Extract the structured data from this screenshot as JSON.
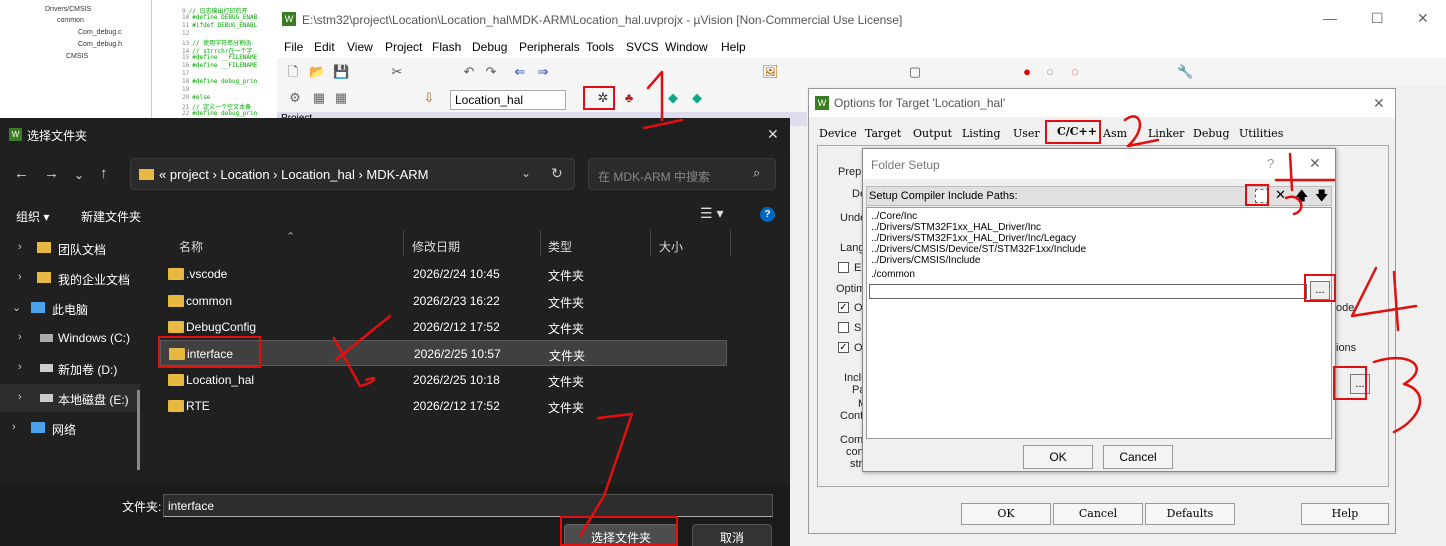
{
  "background_tree": {
    "items": [
      "Drivers/CMSIS",
      "common",
      "Com_debug.c",
      "Com_debug.h",
      "CMSIS"
    ]
  },
  "background_code": {
    "lines": [
      {
        "n": "9",
        "t": "// 日志输出打印的开"
      },
      {
        "n": "10",
        "t": "#define DEBUG_ENAB"
      },
      {
        "n": "11",
        "t": "#ifdef DEBUG_ENABL"
      },
      {
        "n": "12",
        "t": ""
      },
      {
        "n": "13",
        "t": "// 使用字符串分割函"
      },
      {
        "n": "14",
        "t": "// strrchr在一个字"
      },
      {
        "n": "15",
        "t": "#define __FILENAME"
      },
      {
        "n": "16",
        "t": "#define __FILENAME"
      },
      {
        "n": "17",
        "t": ""
      },
      {
        "n": "18",
        "t": "#define debug_prin"
      },
      {
        "n": "19",
        "t": ""
      },
      {
        "n": "20",
        "t": "#else"
      },
      {
        "n": "21",
        "t": "// 定义一个空文本备"
      },
      {
        "n": "22",
        "t": "#define debug_prin"
      }
    ]
  },
  "uvision": {
    "title": "E:\\stm32\\project\\Location\\Location_hal\\MDK-ARM\\Location_hal.uvprojx - µVision  [Non-Commercial Use License]",
    "logo": "W",
    "menu": [
      "File",
      "Edit",
      "View",
      "Project",
      "Flash",
      "Debug",
      "Peripherals",
      "Tools",
      "SVCS",
      "Window",
      "Help"
    ],
    "target": "Location_hal",
    "project_label": "Project"
  },
  "options": {
    "title": "Options for Target 'Location_hal'",
    "tabs": [
      "Device",
      "Target",
      "Output",
      "Listing",
      "User",
      "C/C++",
      "Asm",
      "Linker",
      "Debug",
      "Utilities"
    ],
    "active_tab": "C/C++",
    "labels": {
      "preproc": "Prepro",
      "define": "De",
      "undefine": "Undef",
      "language": "Langu",
      "ex": "Ex",
      "optimiz": "Optimiz",
      "op": "Op",
      "sp": "Sp",
      "on": "On",
      "include1": "Inclu",
      "include2": "Pat",
      "include3": "M",
      "include4": "Contr",
      "comp1": "Comp",
      "comp2": "cont",
      "comp3": "stri",
      "ions": "ions",
      "ode": "ode"
    },
    "browse_label": "...",
    "buttons": {
      "ok": "OK",
      "cancel": "Cancel",
      "defaults": "Defaults",
      "help": "Help"
    }
  },
  "folder_setup": {
    "title": "Folder Setup",
    "help": "?",
    "close": "✕",
    "header": "Setup Compiler Include Paths:",
    "paths": [
      "../Core/Inc",
      "../Drivers/STM32F1xx_HAL_Driver/Inc",
      "../Drivers/STM32F1xx_HAL_Driver/Inc/Legacy",
      "../Drivers/CMSIS/Device/ST/STM32F1xx/Include",
      "../Drivers/CMSIS/Include",
      "./common"
    ],
    "browse_label": "...",
    "ok": "OK",
    "cancel": "Cancel"
  },
  "explorer": {
    "title": "选择文件夹",
    "close": "✕",
    "breadcrumb": "« project › Location › Location_hal › MDK-ARM",
    "search_placeholder": "在 MDK-ARM 中搜索",
    "organize": "组织 ▾",
    "new_folder": "新建文件夹",
    "sidebar": [
      {
        "label": "团队文档",
        "icon": "folder-icon",
        "chevron": "›"
      },
      {
        "label": "我的企业文档",
        "icon": "folder-icon",
        "chevron": "›"
      },
      {
        "label": "此电脑",
        "icon": "computer-icon",
        "chevron": "⌄"
      },
      {
        "label": "Windows (C:)",
        "icon": "drive-icon",
        "chevron": "›"
      },
      {
        "label": "新加卷 (D:)",
        "icon": "drive-icon",
        "chevron": "›"
      },
      {
        "label": "本地磁盘 (E:)",
        "icon": "drive-icon",
        "chevron": "›"
      },
      {
        "label": "网络",
        "icon": "network-icon",
        "chevron": "›"
      }
    ],
    "columns": [
      "名称",
      "修改日期",
      "类型",
      "大小"
    ],
    "rows": [
      {
        "name": ".vscode",
        "date": "2026/2/24 10:45",
        "type": "文件夹"
      },
      {
        "name": "common",
        "date": "2026/2/23 16:22",
        "type": "文件夹"
      },
      {
        "name": "DebugConfig",
        "date": "2026/2/12 17:52",
        "type": "文件夹"
      },
      {
        "name": "interface",
        "date": "2026/2/25 10:57",
        "type": "文件夹"
      },
      {
        "name": "Location_hal",
        "date": "2026/2/25 10:18",
        "type": "文件夹"
      },
      {
        "name": "RTE",
        "date": "2026/2/12 17:52",
        "type": "文件夹"
      }
    ],
    "selected_row": 3,
    "filename_label": "文件夹:",
    "filename_value": "interface",
    "select_button": "选择文件夹",
    "cancel_button": "取消"
  },
  "colors": {
    "annotation": "#e01010",
    "folder": "#e8b940",
    "accent": "#0067c0"
  }
}
